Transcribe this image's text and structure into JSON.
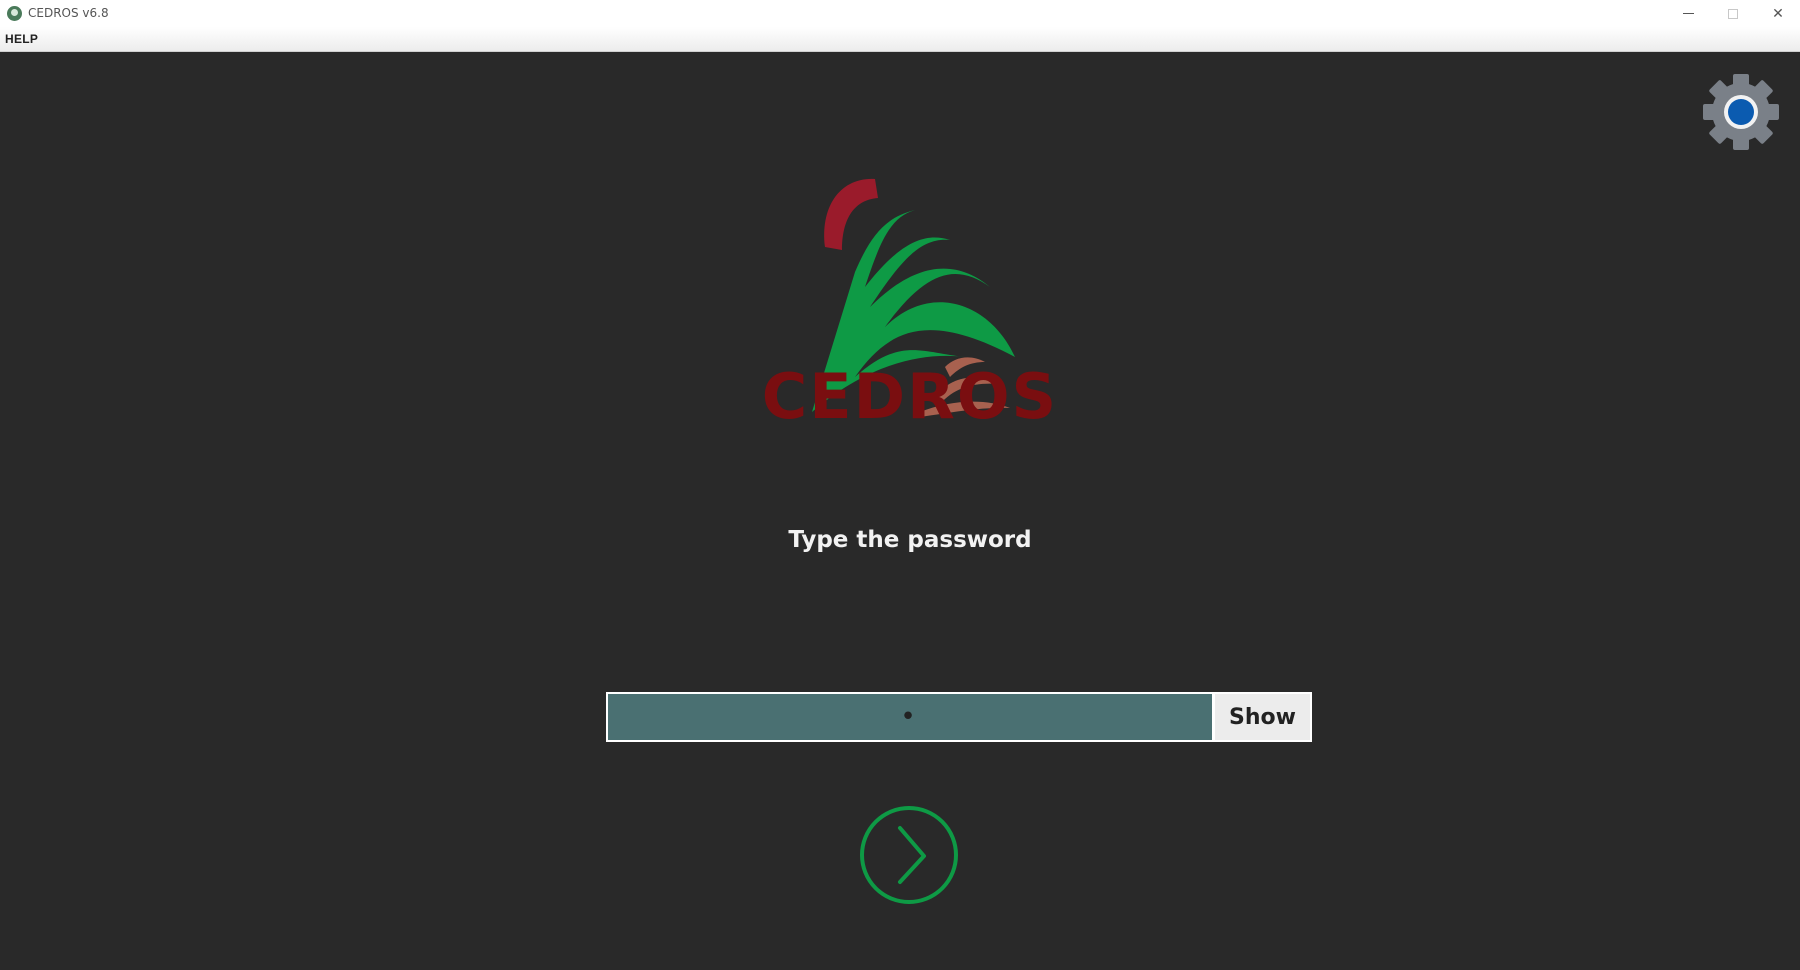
{
  "window": {
    "title": "CEDROS v6.8",
    "controls": {
      "minimize": "—",
      "maximize": "□",
      "close": "✕"
    }
  },
  "menu": {
    "items": [
      {
        "label": "HELP"
      }
    ]
  },
  "logo": {
    "text": "CEDROS",
    "colors": {
      "arc": "#9a1b2b",
      "tree": "#0e9a45",
      "trunk": "#a8614f",
      "text": "#7a0e10"
    }
  },
  "login": {
    "prompt": "Type the password",
    "password_value": "•",
    "show_label": "Show"
  },
  "icons": {
    "settings": "gear-icon",
    "next": "chevron-right-circle-icon"
  },
  "colors": {
    "background": "#292929",
    "input_bg": "#4a7072",
    "accent_green": "#0e9a45",
    "gear": "#7a8088",
    "gear_dot": "#0b5bb0"
  }
}
